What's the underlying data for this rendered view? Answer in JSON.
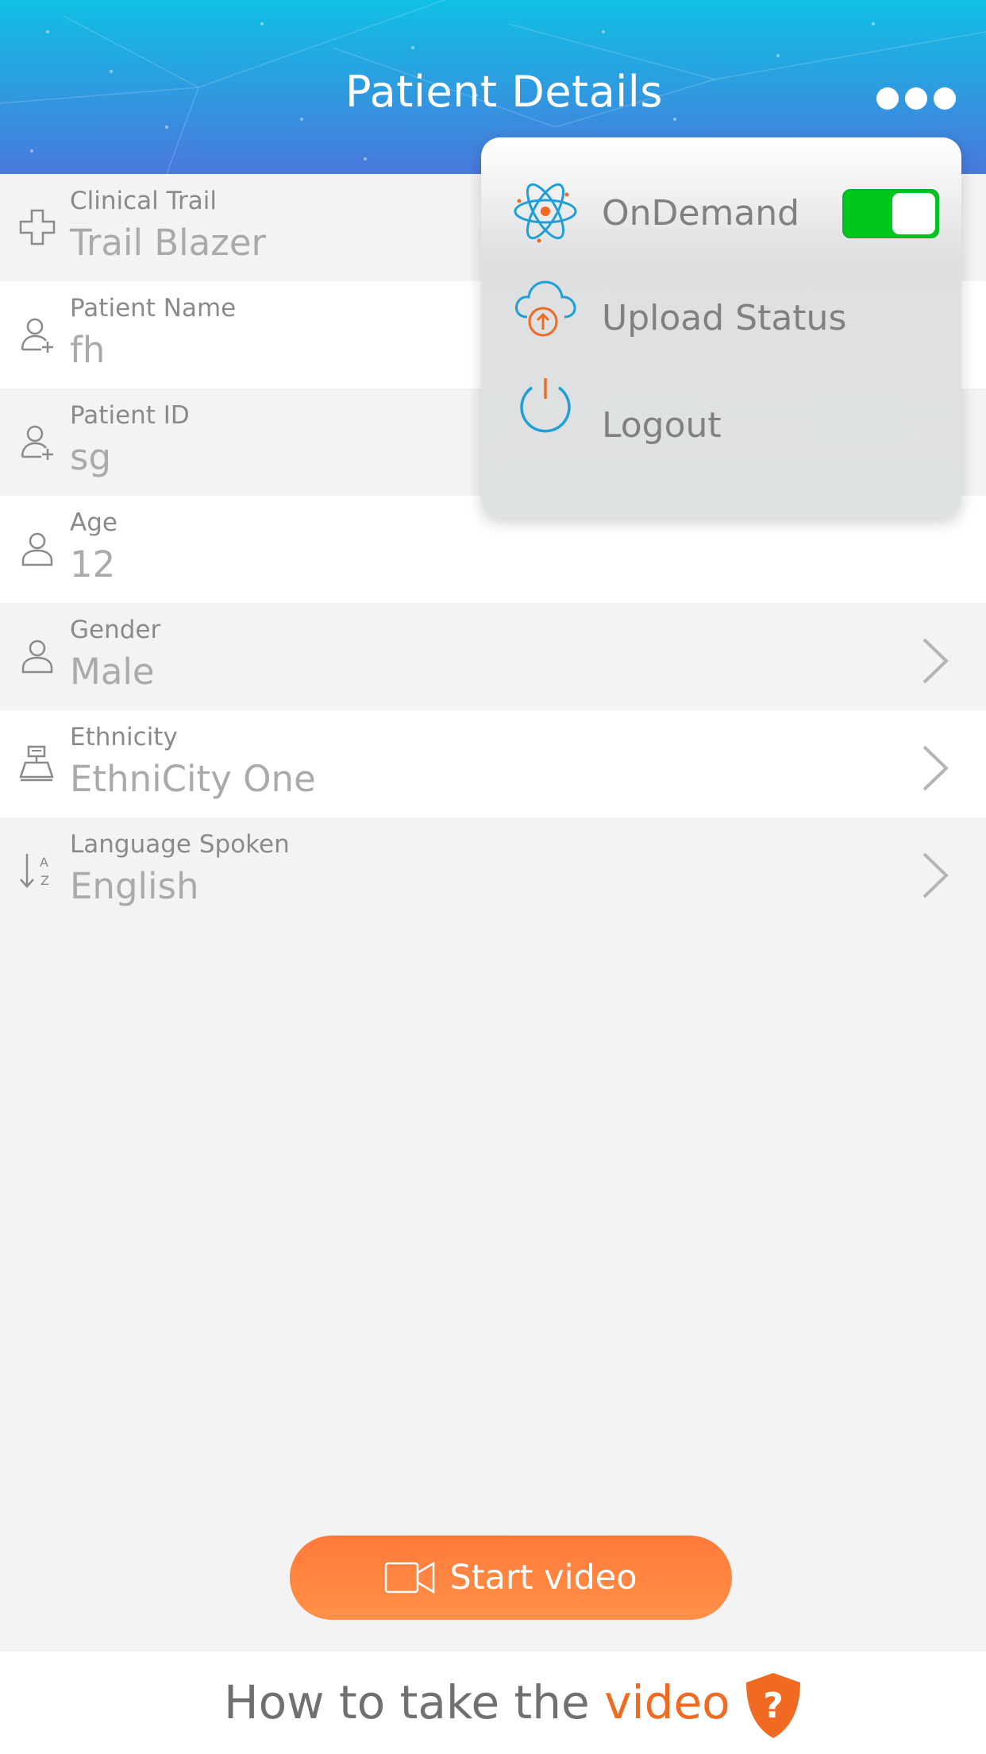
{
  "header": {
    "title": "Patient Details",
    "more_icon": "more-horizontal-icon"
  },
  "rows": [
    {
      "label": "Clinical Trail",
      "value": "Trail Blazer",
      "icon": "medical-cross-icon",
      "chevron": false
    },
    {
      "label": "Patient Name",
      "value": "fh",
      "icon": "add-user-icon",
      "chevron": false
    },
    {
      "label": "Patient ID",
      "value": "sg",
      "icon": "add-user-icon",
      "chevron": false
    },
    {
      "label": "Age",
      "value": "12",
      "icon": "user-icon",
      "chevron": false
    },
    {
      "label": "Gender",
      "value": "Male",
      "icon": "user-icon",
      "chevron": true
    },
    {
      "label": "Ethnicity",
      "value": "EthniCity One",
      "icon": "podium-icon",
      "chevron": true
    },
    {
      "label": "Language Spoken",
      "value": "English",
      "icon": "sort-az-icon",
      "chevron": true
    }
  ],
  "menu": {
    "items": [
      {
        "label": "OnDemand",
        "icon": "atom-icon",
        "toggle_on": true
      },
      {
        "label": "Upload Status",
        "icon": "cloud-upload-icon"
      },
      {
        "label": "Logout",
        "icon": "power-icon"
      }
    ]
  },
  "actions": {
    "start_video": "Start video",
    "start_video_icon": "video-camera-icon"
  },
  "footer": {
    "text_plain": "How to take the",
    "text_accent": "video",
    "help_icon": "help-shield-icon"
  },
  "colors": {
    "accent_orange": "#ff7a3a",
    "toggle_green": "#00c71e",
    "icon_blue": "#1e9fd8"
  }
}
